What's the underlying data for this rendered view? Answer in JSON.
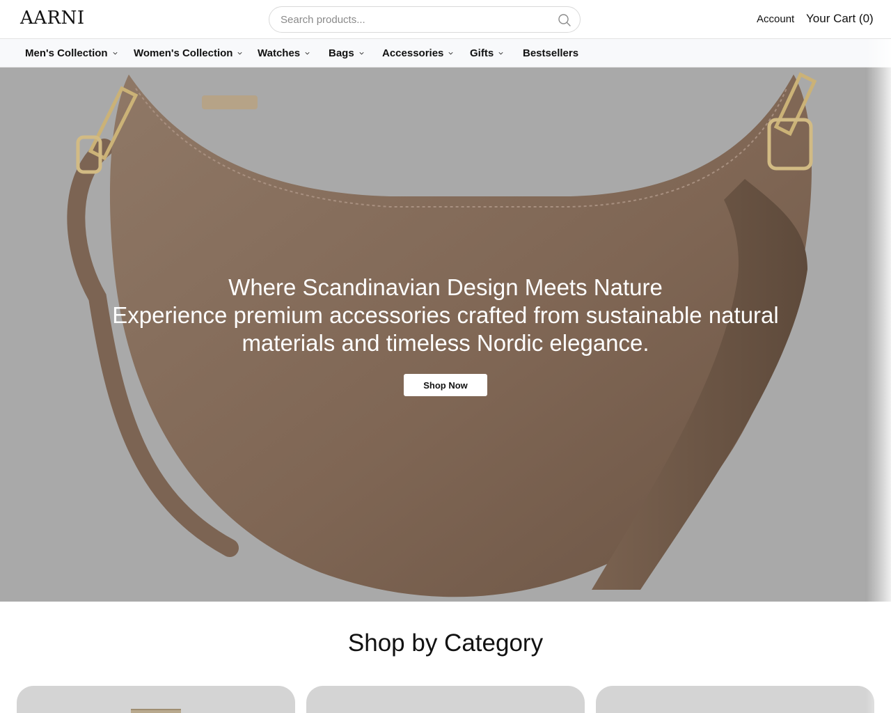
{
  "header": {
    "logo": "AARNI",
    "search_placeholder": "Search products...",
    "account_label": "Account",
    "cart_label": "Your Cart (0)",
    "search_icon": "search-icon"
  },
  "nav": {
    "items": [
      {
        "label": "Men's Collection",
        "has_dropdown": true
      },
      {
        "label": "Women's Collection",
        "has_dropdown": true
      },
      {
        "label": "Watches",
        "has_dropdown": true
      },
      {
        "label": "Bags",
        "has_dropdown": true
      },
      {
        "label": "Accessories",
        "has_dropdown": true
      },
      {
        "label": "Gifts",
        "has_dropdown": true
      },
      {
        "label": "Bestsellers",
        "has_dropdown": false
      }
    ]
  },
  "hero": {
    "title": "Where Scandinavian Design Meets Nature",
    "subtitle": "Experience premium accessories crafted from sustainable natural materials and timeless Nordic elegance.",
    "cta_label": "Shop Now",
    "background_color": "#a9a9a9",
    "bag_color": "#8b7360"
  },
  "categories": {
    "title": "Shop by Category",
    "card_color": "#d4d4d4"
  }
}
